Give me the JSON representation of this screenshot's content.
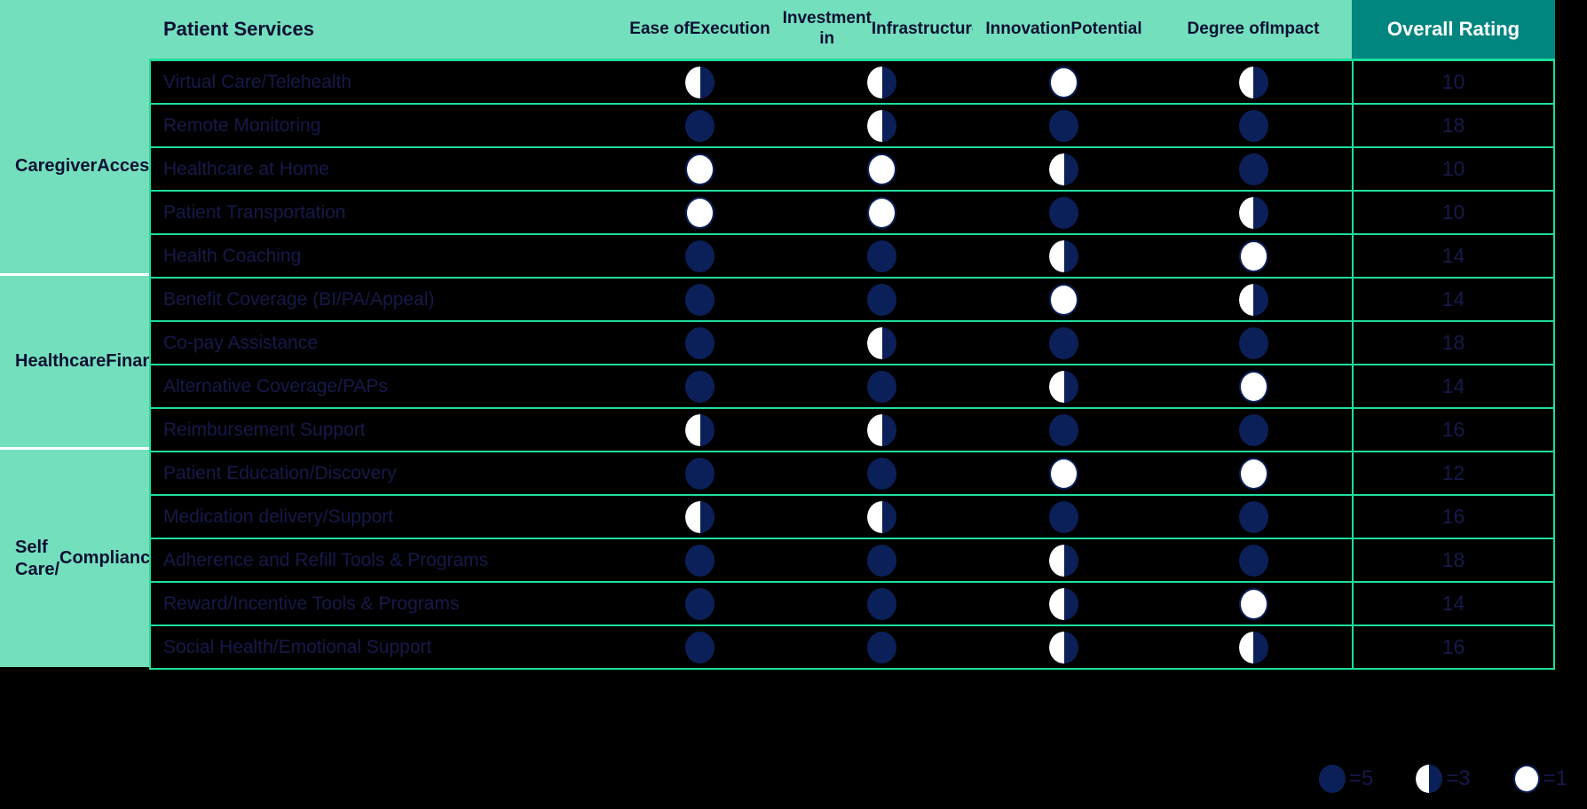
{
  "header": {
    "service_column_label": "Patient Services",
    "criteria": [
      "Ease of\nExecution",
      "Investment in\nInfrastructure",
      "Innovation\nPotential",
      "Degree of\nImpact"
    ],
    "criteria_flat": [
      "Ease of Execution",
      "Investment in Infrastructure",
      "Innovation Potential",
      "Degree of Impact"
    ],
    "overall_label": "Overall Rating"
  },
  "categories": [
    {
      "label": "Caregiver\nAccess",
      "label_flat": "Caregiver Access",
      "row_count": 5
    },
    {
      "label": "Healthcare\nFinancing",
      "label_flat": "Healthcare Financing",
      "row_count": 4
    },
    {
      "label": "Self Care/\nCompliance",
      "label_flat": "Self Care/ Compliance",
      "row_count": 5
    }
  ],
  "rows": [
    {
      "category": "Caregiver Access",
      "service": "Virtual Care/Telehealth",
      "scores": [
        3,
        3,
        1,
        3
      ],
      "rating": "10"
    },
    {
      "category": "Caregiver Access",
      "service": "Remote Monitoring",
      "scores": [
        5,
        3,
        5,
        5
      ],
      "rating": "18"
    },
    {
      "category": "Caregiver Access",
      "service": "Healthcare at Home",
      "scores": [
        1,
        1,
        3,
        5
      ],
      "rating": "10"
    },
    {
      "category": "Caregiver Access",
      "service": "Patient Transportation",
      "scores": [
        1,
        1,
        5,
        3
      ],
      "rating": "10"
    },
    {
      "category": "Caregiver Access",
      "service": "Health Coaching",
      "scores": [
        5,
        5,
        3,
        1
      ],
      "rating": "14"
    },
    {
      "category": "Healthcare Financing",
      "service": "Benefit Coverage (BI/PA/Appeal)",
      "scores": [
        5,
        5,
        1,
        3
      ],
      "rating": "14"
    },
    {
      "category": "Healthcare Financing",
      "service": "Co-pay Assistance",
      "scores": [
        5,
        3,
        5,
        5
      ],
      "rating": "18"
    },
    {
      "category": "Healthcare Financing",
      "service": "Alternative Coverage/PAPs",
      "scores": [
        5,
        5,
        3,
        1
      ],
      "rating": "14"
    },
    {
      "category": "Healthcare Financing",
      "service": "Reimbursement Support",
      "scores": [
        3,
        3,
        5,
        5
      ],
      "rating": "16"
    },
    {
      "category": "Self Care/ Compliance",
      "service": "Patient Education/Discovery",
      "scores": [
        5,
        5,
        1,
        1
      ],
      "rating": "12"
    },
    {
      "category": "Self Care/ Compliance",
      "service": "Medication delivery/Support",
      "scores": [
        3,
        3,
        5,
        5
      ],
      "rating": "16"
    },
    {
      "category": "Self Care/ Compliance",
      "service": "Adherence and Refill Tools & Programs",
      "scores": [
        5,
        5,
        3,
        5
      ],
      "rating": "18"
    },
    {
      "category": "Self Care/ Compliance",
      "service": "Reward/Incentive Tools & Programs",
      "scores": [
        5,
        5,
        3,
        1
      ],
      "rating": "14"
    },
    {
      "category": "Self Care/ Compliance",
      "service": "Social Health/Emotional Support",
      "scores": [
        5,
        5,
        3,
        3
      ],
      "rating": "16"
    }
  ],
  "legend": [
    {
      "symbol": "full-circle",
      "value": 5,
      "label": "=5"
    },
    {
      "symbol": "half-circle",
      "value": 3,
      "label": "=3"
    },
    {
      "symbol": "empty-circle",
      "value": 1,
      "label": "=1"
    }
  ],
  "colors": {
    "background": "#000000",
    "header_mint": "#74DFBD",
    "overall_teal": "#00857F",
    "grid_green": "#1EDD9B",
    "text_navy": "#0B1033",
    "row_text_navy": "#16194A",
    "ball_navy": "#0B2059",
    "ball_white": "#FFFFFF"
  }
}
